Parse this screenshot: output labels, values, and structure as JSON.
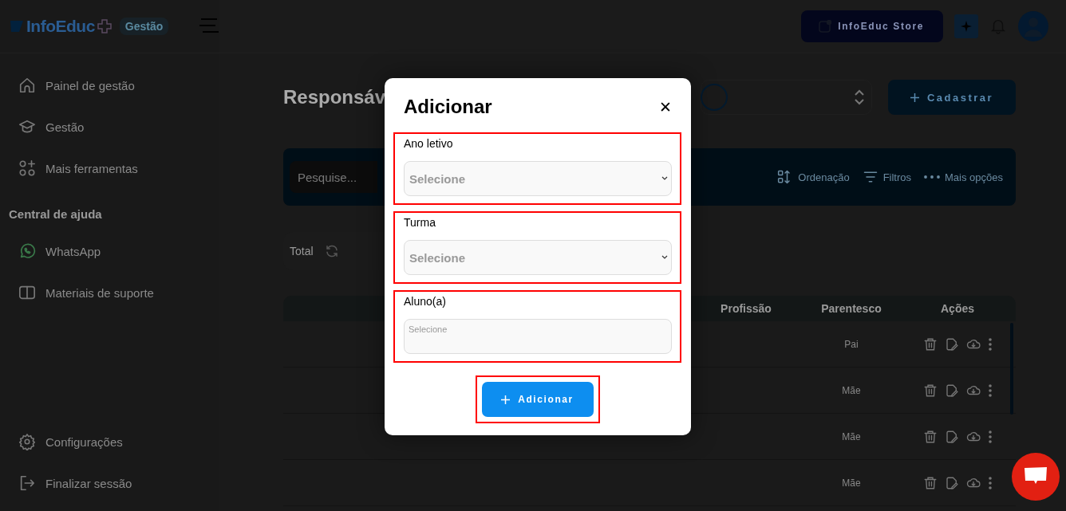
{
  "header": {
    "logo": "InfoEduc",
    "badge": "Gestão",
    "store_button": "InfoEduc Store"
  },
  "sidebar": {
    "items": [
      {
        "label": "Painel de gestão"
      },
      {
        "label": "Gestão"
      },
      {
        "label": "Mais ferramentas"
      }
    ],
    "help_title": "Central de ajuda",
    "help_items": [
      {
        "label": "WhatsApp"
      },
      {
        "label": "Materiais de suporte"
      }
    ],
    "bottom_items": [
      {
        "label": "Configurações"
      },
      {
        "label": "Finalizar sessão"
      }
    ]
  },
  "main": {
    "title": "Responsáv",
    "register_button": "Cadastrar",
    "toolbar": {
      "search_placeholder": "Pesquise...",
      "actions": [
        {
          "label": "Ordenação"
        },
        {
          "label": "Filtros"
        },
        {
          "label": "Mais opções"
        }
      ]
    },
    "total_label": "Total",
    "table": {
      "columns": [
        "Profissão",
        "Parentesco",
        "Ações"
      ],
      "rows": [
        {
          "parentesco": "Pai"
        },
        {
          "parentesco": "Mãe"
        },
        {
          "parentesco": "Mãe"
        },
        {
          "parentesco": "Mãe"
        }
      ]
    }
  },
  "modal": {
    "title": "Adicionar",
    "close": "✕",
    "fields": [
      {
        "label": "Ano letivo",
        "kind": "select",
        "placeholder": "Selecione",
        "highlighted": true
      },
      {
        "label": "Turma",
        "kind": "select",
        "placeholder": "Selecione",
        "highlighted": true
      },
      {
        "label": "Aluno(a)",
        "kind": "multiselect",
        "placeholder": "Selecione",
        "highlighted": true
      }
    ],
    "submit": {
      "label": "Adicionar",
      "highlighted": true
    }
  }
}
